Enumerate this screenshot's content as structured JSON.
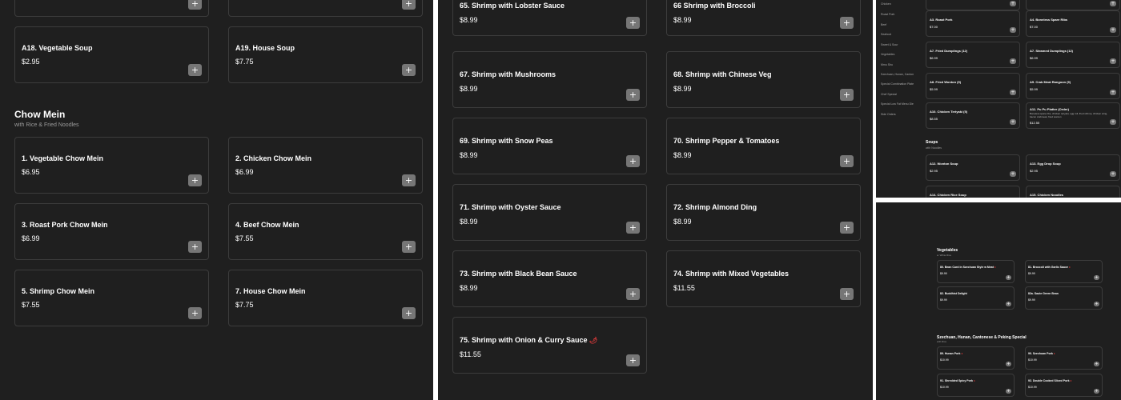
{
  "accent": "#767676",
  "background": "#1f1f1f",
  "hot_color": "#e03a3a",
  "add_icon": "+",
  "spicy_icon": "🌶",
  "hot_mark": "♦",
  "panel1": {
    "top_items": [
      {
        "name": "A18. Vegetable Soup",
        "price": "$2.95"
      },
      {
        "name": "A19. House Soup",
        "price": "$7.75"
      }
    ],
    "section_title": "Chow Mein",
    "section_subtitle": "with Rice & Fried Noodles",
    "items": [
      {
        "name": "1. Vegetable Chow Mein",
        "price": "$6.95"
      },
      {
        "name": "2. Chicken Chow Mein",
        "price": "$6.99"
      },
      {
        "name": "3. Roast Pork Chow Mein",
        "price": "$6.99"
      },
      {
        "name": "4. Beef Chow Mein",
        "price": "$7.55"
      },
      {
        "name": "5. Shrimp Chow Mein",
        "price": "$7.55"
      },
      {
        "name": "7. House Chow Mein",
        "price": "$7.75"
      }
    ]
  },
  "panel2": {
    "items": [
      {
        "name": "65. Shrimp with Lobster Sauce",
        "price": "$8.99"
      },
      {
        "name": "66 Shrimp with Broccoli",
        "price": "$8.99"
      },
      {
        "name": "67. Shrimp with Mushrooms",
        "price": "$8.99"
      },
      {
        "name": "68. Shrimp with Chinese Veg",
        "price": "$8.99"
      },
      {
        "name": "69. Shrimp with Snow Peas",
        "price": "$8.99"
      },
      {
        "name": "70. Shrimp Pepper & Tomatoes",
        "price": "$8.99"
      },
      {
        "name": "71. Shrimp with Oyster Sauce",
        "price": "$8.99"
      },
      {
        "name": "72. Shrimp Almond Ding",
        "price": "$8.99"
      },
      {
        "name": "73. Shrimp with Black Bean Sauce",
        "price": "$8.99"
      },
      {
        "name": "74. Shrimp with Mixed Vegetables",
        "price": "$11.55"
      },
      {
        "name": "75. Shrimp with Onion & Curry Sauce",
        "price": "$11.55"
      }
    ]
  },
  "panel3": {
    "sidebar": [
      "Chicken",
      "Roast Pork",
      "Beef",
      "Seafood",
      "Sweet & Sour",
      "Vegetables",
      "Mmu Shu",
      "Szechuan, Hunan, Canton",
      "Special Combination Plate",
      "Chef Special",
      "Special Low Fat Menu Die",
      "Side Orders"
    ],
    "items": [
      {
        "name": "A3. Roast Pork",
        "price": "$7.00"
      },
      {
        "name": "A4. Boneless Spare Ribs",
        "price": "$7.00"
      },
      {
        "name": "A7. Fried Dumplings (12)",
        "price": "$6.99"
      },
      {
        "name": "A7. Steamed Dumplings (12)",
        "price": "$6.99"
      },
      {
        "name": "A8. Fried Wonton (9)",
        "price": "$5.99"
      },
      {
        "name": "A9. Crab Meat Rangoon (9)",
        "price": "$5.99"
      },
      {
        "name": "A10. Chicken Teriyaki (5)",
        "price": "$8.55"
      },
      {
        "name": "A11. Pu Pu Platter (Order)",
        "desc": "Boneless spare ribs, chicken teriyaki, egg roll, fried shrimp, chicken wing, bacon crabmeat, fried wonton",
        "price": "$12.55"
      }
    ],
    "soups_title": "Soups",
    "soups_subtitle": "with Noodles",
    "soups": [
      {
        "name": "A12. Wonton Soup",
        "price": "$2.95"
      },
      {
        "name": "A13. Egg Drop Soup",
        "price": "$2.95"
      },
      {
        "name": "A14. Chicken Rice Soup",
        "price": ""
      },
      {
        "name": "A15. Chicken Noodles",
        "price": ""
      }
    ]
  },
  "panel4": {
    "veg_title": "Vegetables",
    "veg_subtitle": "w. White Rice",
    "veg_items": [
      {
        "name": "80. Bean Curd in Szechuan Style w Meat",
        "price": "$9.99",
        "hot": true
      },
      {
        "name": "81. Broccoli with Garlic Sauce",
        "price": "$9.99",
        "hot": true
      },
      {
        "name": "82. Buddhist Delight",
        "price": "$9.99",
        "hot": false
      },
      {
        "name": "82a. Saute Green Bean",
        "price": "$9.99",
        "hot": false
      }
    ],
    "sz_title": "Szechuan, Hunan, Cantonese & Peking Special",
    "sz_subtitle": "with Rice",
    "sz_items": [
      {
        "name": "89. Hunan Pork",
        "price": "$10.99",
        "hot": true
      },
      {
        "name": "90. Szechuan Pork",
        "price": "$10.99",
        "hot": true
      },
      {
        "name": "91. Shredded Spicy Pork",
        "price": "$10.99",
        "hot": true
      },
      {
        "name": "92. Double Cooked Sliced Pork",
        "price": "$10.99",
        "hot": true
      }
    ]
  }
}
